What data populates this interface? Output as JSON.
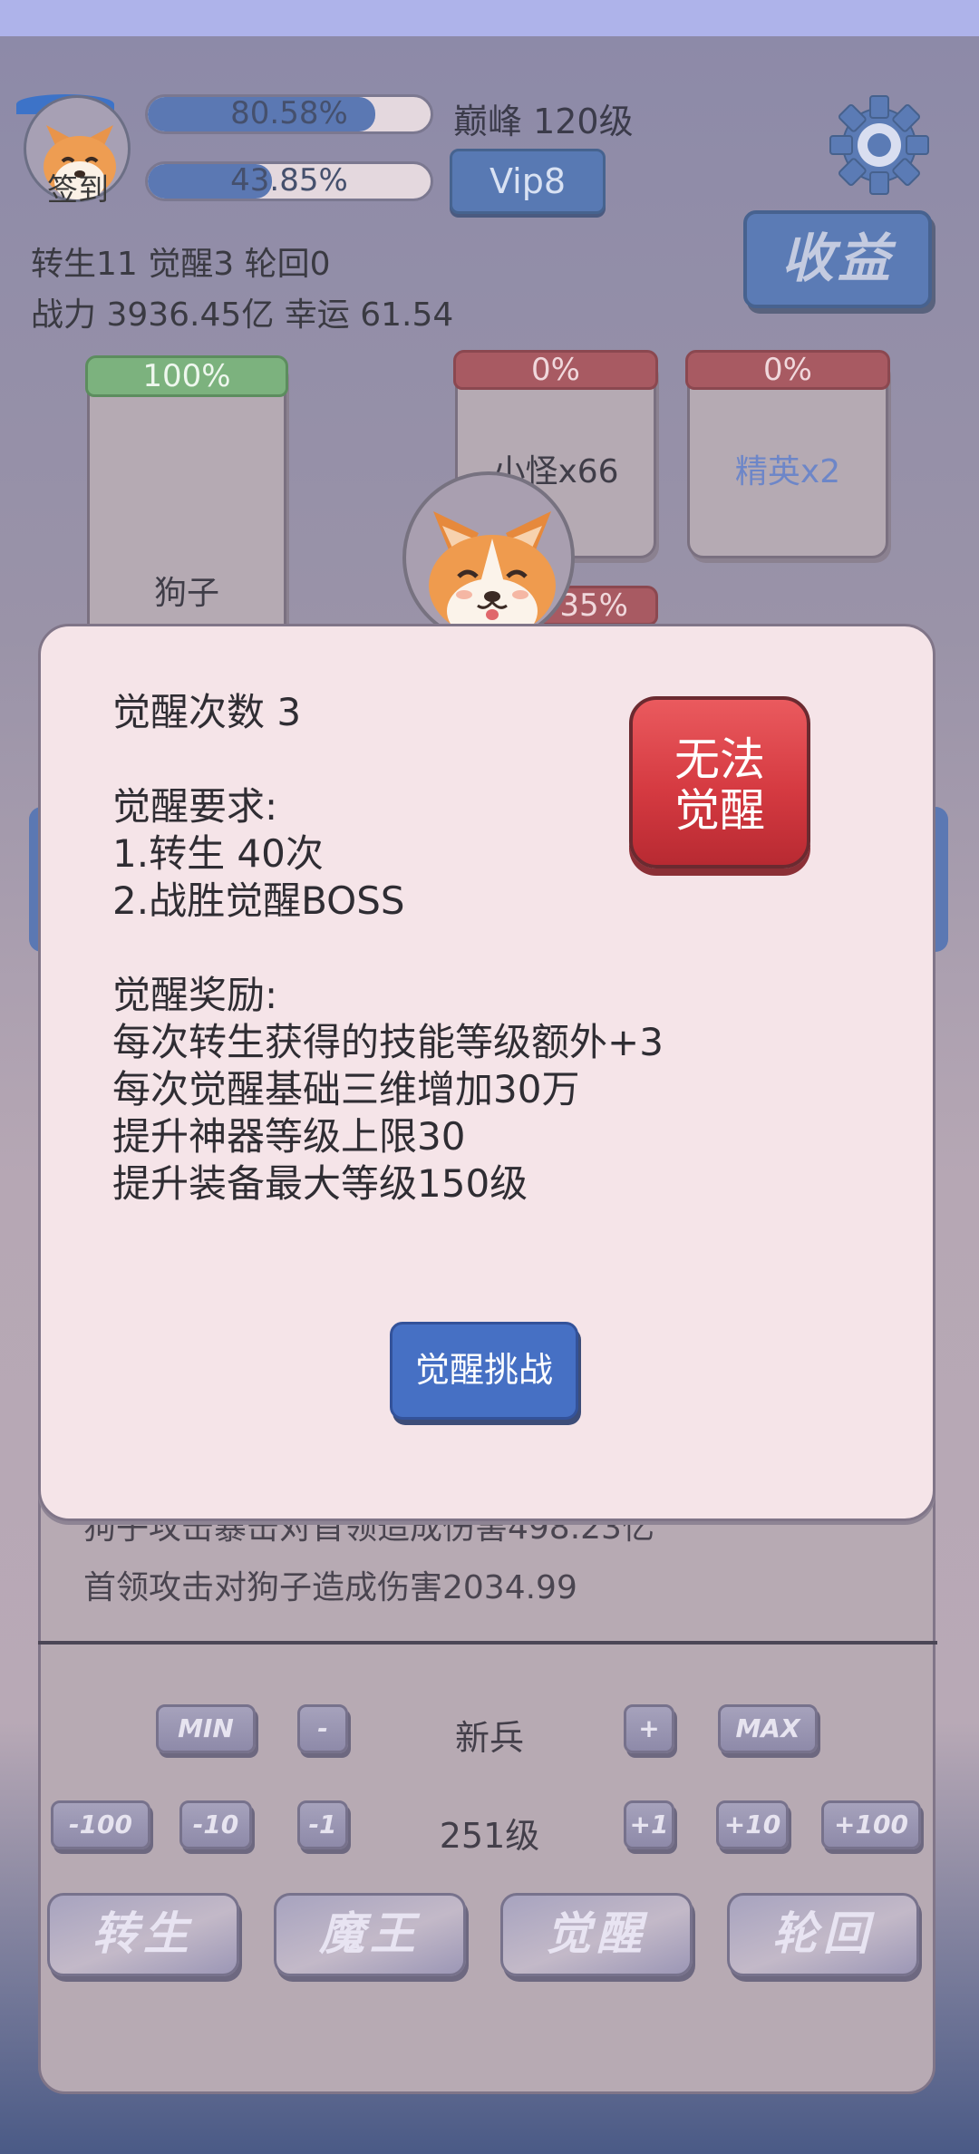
{
  "header": {
    "signin_label": "签到",
    "exp_bar": {
      "text": "80.58%",
      "fill": 0.8058
    },
    "second_bar": {
      "text": "43.85%",
      "fill": 0.4385
    },
    "peak_label": "巅峰 120级",
    "vip_label": "Vip8",
    "income_label": "收益"
  },
  "stats": {
    "line1": "转生11 觉醒3 轮回0",
    "line2": "战力 3936.45亿  幸运 61.54"
  },
  "cards": {
    "player": {
      "badge": "100%",
      "label": "狗子"
    },
    "minion": {
      "badge": "0%",
      "label": "小怪x66"
    },
    "elite": {
      "badge": "0%",
      "label": "精英x2"
    },
    "boss_badge_partial": "35%"
  },
  "dialog": {
    "count_line": "觉醒次数 3",
    "req_title": "觉醒要求:",
    "req_1": "1.转生 40次",
    "req_2": "2.战胜觉醒BOSS",
    "reward_title": "觉醒奖励:",
    "reward_1": "每次转生获得的技能等级额外+3",
    "reward_2": "每次觉醒基础三维增加30万",
    "reward_3": "提升神器等级上限30",
    "reward_4": "提升装备最大等级150级",
    "cannot_line1": "无法",
    "cannot_line2": "觉醒",
    "challenge_label": "觉醒挑战"
  },
  "log": {
    "partial_line": "狗子攻击暴击对首领造成伤害498.23亿",
    "line": "首领攻击对狗子造成伤害2034.99"
  },
  "controls": {
    "row1": {
      "min": "MIN",
      "minus": "-",
      "center": "新兵",
      "plus": "+",
      "max": "MAX"
    },
    "row2": {
      "m100": "-100",
      "m10": "-10",
      "m1": "-1",
      "center": "251级",
      "p1": "+1",
      "p10": "+10",
      "p100": "+100"
    },
    "actions": [
      "转生",
      "魔王",
      "觉醒",
      "轮回"
    ]
  },
  "colors": {
    "accent_blue": "#5b78b3",
    "danger_red": "#d53a41",
    "dialog_bg": "#f5e4e8"
  }
}
